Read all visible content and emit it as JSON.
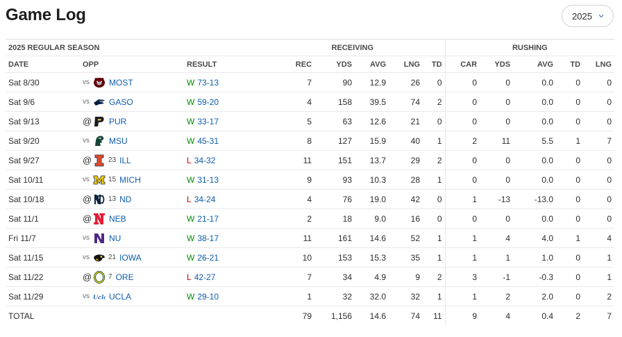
{
  "header": {
    "title": "Game Log"
  },
  "season_select": {
    "value": "2025"
  },
  "table": {
    "section_label": "2025 REGULAR SEASON",
    "group_receiving": "RECEIVING",
    "group_rushing": "RUSHING",
    "columns": [
      "DATE",
      "OPP",
      "RESULT",
      "REC",
      "YDS",
      "AVG",
      "LNG",
      "TD",
      "CAR",
      "YDS",
      "AVG",
      "TD",
      "LNG"
    ],
    "rows": [
      {
        "date": "Sat 8/30",
        "loc": "vs",
        "rank": "",
        "team": "MOST",
        "logo": "missouri-state-bears-logo",
        "wl": "W",
        "score": "73-13",
        "rec": [
          "7",
          "90",
          "12.9",
          "26",
          "0"
        ],
        "rush": [
          "0",
          "0",
          "0.0",
          "0",
          "0"
        ]
      },
      {
        "date": "Sat 9/6",
        "loc": "vs",
        "rank": "",
        "team": "GASO",
        "logo": "georgia-southern-eagle-logo",
        "wl": "W",
        "score": "59-20",
        "rec": [
          "4",
          "158",
          "39.5",
          "74",
          "2"
        ],
        "rush": [
          "0",
          "0",
          "0.0",
          "0",
          "0"
        ]
      },
      {
        "date": "Sat 9/13",
        "loc": "@",
        "rank": "",
        "team": "PUR",
        "logo": "purdue-p-logo",
        "wl": "W",
        "score": "33-17",
        "rec": [
          "5",
          "63",
          "12.6",
          "21",
          "0"
        ],
        "rush": [
          "0",
          "0",
          "0.0",
          "0",
          "0"
        ]
      },
      {
        "date": "Sat 9/20",
        "loc": "vs",
        "rank": "",
        "team": "MSU",
        "logo": "michigan-state-spartan-logo",
        "wl": "W",
        "score": "45-31",
        "rec": [
          "8",
          "127",
          "15.9",
          "40",
          "1"
        ],
        "rush": [
          "2",
          "11",
          "5.5",
          "1",
          "7"
        ]
      },
      {
        "date": "Sat 9/27",
        "loc": "@",
        "rank": "23",
        "team": "ILL",
        "logo": "illinois-i-logo",
        "wl": "L",
        "score": "34-32",
        "rec": [
          "11",
          "151",
          "13.7",
          "29",
          "2"
        ],
        "rush": [
          "0",
          "0",
          "0.0",
          "0",
          "0"
        ]
      },
      {
        "date": "Sat 10/11",
        "loc": "vs",
        "rank": "15",
        "team": "MICH",
        "logo": "michigan-m-logo",
        "wl": "W",
        "score": "31-13",
        "rec": [
          "9",
          "93",
          "10.3",
          "28",
          "1"
        ],
        "rush": [
          "0",
          "0",
          "0.0",
          "0",
          "0"
        ]
      },
      {
        "date": "Sat 10/18",
        "loc": "@",
        "rank": "13",
        "team": "ND",
        "logo": "notre-dame-nd-logo",
        "wl": "L",
        "score": "34-24",
        "rec": [
          "4",
          "76",
          "19.0",
          "42",
          "0"
        ],
        "rush": [
          "1",
          "-13",
          "-13.0",
          "0",
          "0"
        ]
      },
      {
        "date": "Sat 11/1",
        "loc": "@",
        "rank": "",
        "team": "NEB",
        "logo": "nebraska-n-logo",
        "wl": "W",
        "score": "21-17",
        "rec": [
          "2",
          "18",
          "9.0",
          "16",
          "0"
        ],
        "rush": [
          "0",
          "0",
          "0.0",
          "0",
          "0"
        ]
      },
      {
        "date": "Fri 11/7",
        "loc": "vs",
        "rank": "",
        "team": "NU",
        "logo": "northwestern-n-logo",
        "wl": "W",
        "score": "38-17",
        "rec": [
          "11",
          "161",
          "14.6",
          "52",
          "1"
        ],
        "rush": [
          "1",
          "4",
          "4.0",
          "1",
          "4"
        ]
      },
      {
        "date": "Sat 11/15",
        "loc": "vs",
        "rank": "21",
        "team": "IOWA",
        "logo": "iowa-hawkeye-logo",
        "wl": "W",
        "score": "26-21",
        "rec": [
          "10",
          "153",
          "15.3",
          "35",
          "1"
        ],
        "rush": [
          "1",
          "1",
          "1.0",
          "0",
          "1"
        ]
      },
      {
        "date": "Sat 11/22",
        "loc": "@",
        "rank": "7",
        "team": "ORE",
        "logo": "oregon-o-logo",
        "wl": "L",
        "score": "42-27",
        "rec": [
          "7",
          "34",
          "4.9",
          "9",
          "2"
        ],
        "rush": [
          "3",
          "-1",
          "-0.3",
          "0",
          "1"
        ]
      },
      {
        "date": "Sat 11/29",
        "loc": "vs",
        "rank": "",
        "team": "UCLA",
        "logo": "ucla-script-logo",
        "wl": "W",
        "score": "29-10",
        "rec": [
          "1",
          "32",
          "32.0",
          "32",
          "1"
        ],
        "rush": [
          "1",
          "2",
          "2.0",
          "0",
          "2"
        ]
      }
    ],
    "total": {
      "label": "TOTAL",
      "rec": [
        "79",
        "1,156",
        "14.6",
        "74",
        "11"
      ],
      "rush": [
        "9",
        "4",
        "0.4",
        "2",
        "7"
      ]
    }
  },
  "colors": {
    "win": "#008a00",
    "loss": "#d00000",
    "link": "#0d5cad"
  }
}
